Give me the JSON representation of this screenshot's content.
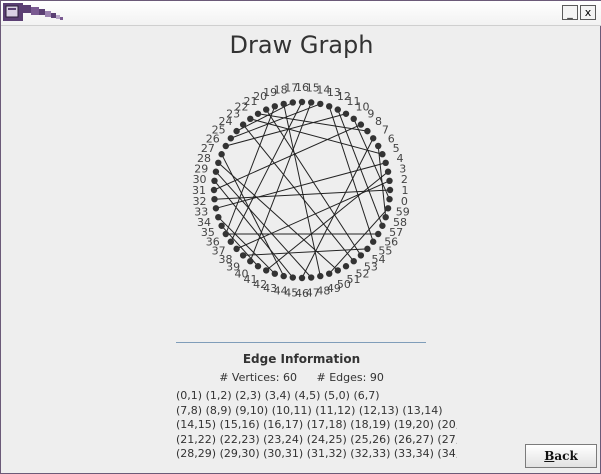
{
  "window": {
    "minimize_label": "_",
    "close_label": "x"
  },
  "page": {
    "title": "Draw Graph"
  },
  "graph": {
    "vertex_count": 60,
    "vertex_labels": [
      "0",
      "1",
      "2",
      "3",
      "4",
      "5",
      "6",
      "7",
      "8",
      "9",
      "10",
      "11",
      "12",
      "13",
      "14",
      "15",
      "16",
      "17",
      "18",
      "19",
      "20",
      "21",
      "22",
      "23",
      "24",
      "25",
      "26",
      "27",
      "28",
      "29",
      "30",
      "31",
      "32",
      "33",
      "34",
      "35",
      "36",
      "37",
      "38",
      "39",
      "40",
      "41",
      "42",
      "43",
      "44",
      "45",
      "46",
      "47",
      "48",
      "49",
      "50",
      "51",
      "52",
      "53",
      "54",
      "55",
      "56",
      "57",
      "58",
      "59"
    ],
    "edges": [
      [
        13,
        55
      ],
      [
        5,
        22
      ],
      [
        6,
        58
      ],
      [
        8,
        21
      ],
      [
        12,
        57
      ],
      [
        9,
        31
      ],
      [
        10,
        60
      ],
      [
        11,
        26
      ],
      [
        3,
        42
      ],
      [
        4,
        33
      ],
      [
        2,
        38
      ],
      [
        14,
        25
      ],
      [
        15,
        40
      ],
      [
        30,
        45
      ],
      [
        29,
        47
      ],
      [
        27,
        44
      ],
      [
        28,
        50
      ],
      [
        16,
        37
      ],
      [
        17,
        24
      ],
      [
        19,
        36
      ],
      [
        20,
        53
      ],
      [
        32,
        1
      ],
      [
        34,
        43
      ],
      [
        35,
        41
      ],
      [
        46,
        7
      ],
      [
        48,
        18
      ],
      [
        49,
        59
      ],
      [
        52,
        23
      ],
      [
        54,
        39
      ],
      [
        56,
        36
      ]
    ]
  },
  "edge_info": {
    "heading": "Edge Information",
    "vertices_label": "# Vertices: 60",
    "edges_label": "# Edges: 90",
    "lines": [
      "(0,1) (1,2) (2,3) (3,4) (4,5) (5,0) (6,7)",
      "(7,8) (8,9) (9,10) (10,11) (11,12) (12,13) (13,14)",
      "(14,15) (15,16) (16,17) (17,18) (18,19) (19,20) (20,6",
      "(21,22) (22,23) (23,24) (24,25) (25,26) (26,27) (27,2",
      "(28,29) (29,30) (30,31) (31,32) (32,33) (33,34) (34,3"
    ]
  },
  "buttons": {
    "back_label_first": "B",
    "back_label_rest": "ack"
  },
  "colors": {
    "node": "#333333",
    "edge": "#222222",
    "label": "#444444",
    "separator": "#7f9db9"
  }
}
